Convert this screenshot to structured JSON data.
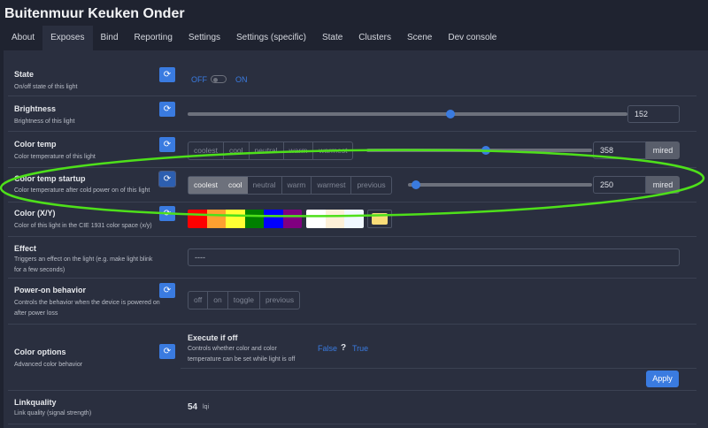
{
  "title": "Buitenmuur Keuken Onder",
  "tabs": [
    "About",
    "Exposes",
    "Bind",
    "Reporting",
    "Settings",
    "Settings (specific)",
    "State",
    "Clusters",
    "Scene",
    "Dev console"
  ],
  "active_tab": "Exposes",
  "state": {
    "label": "State",
    "desc": "On/off state of this light",
    "off": "OFF",
    "on": "ON",
    "value": "OFF"
  },
  "brightness": {
    "label": "Brightness",
    "desc": "Brightness of this light",
    "value": "152",
    "fraction": 0.6
  },
  "color_temp": {
    "label": "Color temp",
    "desc": "Color temperature of this light",
    "presets": [
      "coolest",
      "cool",
      "neutral",
      "warm",
      "warmest"
    ],
    "value": "358",
    "unit": "mired",
    "fraction": 0.53
  },
  "color_temp_startup": {
    "label": "Color temp startup",
    "desc": "Color temperature after cold power on of this light",
    "presets": [
      "coolest",
      "cool",
      "neutral",
      "warm",
      "warmest",
      "previous"
    ],
    "value": "250",
    "unit": "mired",
    "fraction": 0.02
  },
  "color_xy": {
    "label": "Color (X/Y)",
    "desc": "Color of this light in the CIE 1931 color space (x/y)",
    "swatches": [
      "#ff0000",
      "#ffa030",
      "#ffff33",
      "#008000",
      "#0000ff",
      "#800080"
    ],
    "whites": [
      "#ffffff",
      "#fdf0d8",
      "#f0f8ff"
    ],
    "current": "#f8dc78"
  },
  "effect": {
    "label": "Effect",
    "desc": "Triggers an effect on the light (e.g. make light blink for a few seconds)",
    "value": "----"
  },
  "power_on": {
    "label": "Power-on behavior",
    "desc": "Controls the behavior when the device is powered on after power loss",
    "options": [
      "off",
      "on",
      "toggle",
      "previous"
    ]
  },
  "color_options": {
    "label": "Color options",
    "desc": "Advanced color behavior",
    "sub_label": "Execute if off",
    "sub_desc": "Controls whether color and color temperature can be set while light is off",
    "false": "False",
    "unknown": "?",
    "true": "True",
    "apply": "Apply"
  },
  "linkquality": {
    "label": "Linkquality",
    "desc": "Link quality (signal strength)",
    "value": "54",
    "unit": "lqi"
  }
}
